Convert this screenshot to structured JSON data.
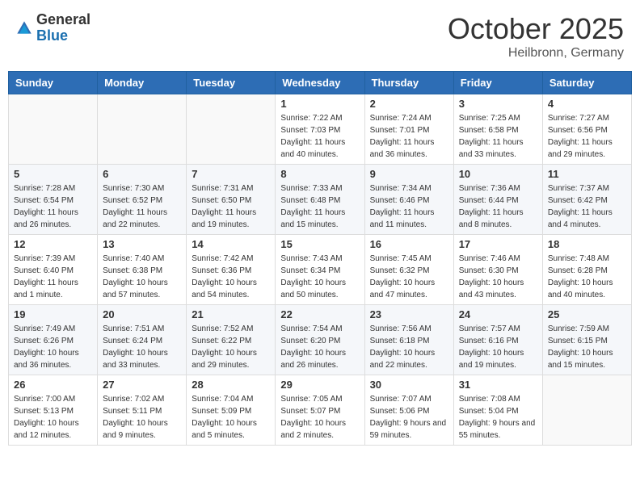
{
  "header": {
    "logo_general": "General",
    "logo_blue": "Blue",
    "month_title": "October 2025",
    "location": "Heilbronn, Germany"
  },
  "calendar": {
    "days_of_week": [
      "Sunday",
      "Monday",
      "Tuesday",
      "Wednesday",
      "Thursday",
      "Friday",
      "Saturday"
    ],
    "weeks": [
      [
        {
          "day": "",
          "sunrise": "",
          "sunset": "",
          "daylight": ""
        },
        {
          "day": "",
          "sunrise": "",
          "sunset": "",
          "daylight": ""
        },
        {
          "day": "",
          "sunrise": "",
          "sunset": "",
          "daylight": ""
        },
        {
          "day": "1",
          "sunrise": "Sunrise: 7:22 AM",
          "sunset": "Sunset: 7:03 PM",
          "daylight": "Daylight: 11 hours and 40 minutes."
        },
        {
          "day": "2",
          "sunrise": "Sunrise: 7:24 AM",
          "sunset": "Sunset: 7:01 PM",
          "daylight": "Daylight: 11 hours and 36 minutes."
        },
        {
          "day": "3",
          "sunrise": "Sunrise: 7:25 AM",
          "sunset": "Sunset: 6:58 PM",
          "daylight": "Daylight: 11 hours and 33 minutes."
        },
        {
          "day": "4",
          "sunrise": "Sunrise: 7:27 AM",
          "sunset": "Sunset: 6:56 PM",
          "daylight": "Daylight: 11 hours and 29 minutes."
        }
      ],
      [
        {
          "day": "5",
          "sunrise": "Sunrise: 7:28 AM",
          "sunset": "Sunset: 6:54 PM",
          "daylight": "Daylight: 11 hours and 26 minutes."
        },
        {
          "day": "6",
          "sunrise": "Sunrise: 7:30 AM",
          "sunset": "Sunset: 6:52 PM",
          "daylight": "Daylight: 11 hours and 22 minutes."
        },
        {
          "day": "7",
          "sunrise": "Sunrise: 7:31 AM",
          "sunset": "Sunset: 6:50 PM",
          "daylight": "Daylight: 11 hours and 19 minutes."
        },
        {
          "day": "8",
          "sunrise": "Sunrise: 7:33 AM",
          "sunset": "Sunset: 6:48 PM",
          "daylight": "Daylight: 11 hours and 15 minutes."
        },
        {
          "day": "9",
          "sunrise": "Sunrise: 7:34 AM",
          "sunset": "Sunset: 6:46 PM",
          "daylight": "Daylight: 11 hours and 11 minutes."
        },
        {
          "day": "10",
          "sunrise": "Sunrise: 7:36 AM",
          "sunset": "Sunset: 6:44 PM",
          "daylight": "Daylight: 11 hours and 8 minutes."
        },
        {
          "day": "11",
          "sunrise": "Sunrise: 7:37 AM",
          "sunset": "Sunset: 6:42 PM",
          "daylight": "Daylight: 11 hours and 4 minutes."
        }
      ],
      [
        {
          "day": "12",
          "sunrise": "Sunrise: 7:39 AM",
          "sunset": "Sunset: 6:40 PM",
          "daylight": "Daylight: 11 hours and 1 minute."
        },
        {
          "day": "13",
          "sunrise": "Sunrise: 7:40 AM",
          "sunset": "Sunset: 6:38 PM",
          "daylight": "Daylight: 10 hours and 57 minutes."
        },
        {
          "day": "14",
          "sunrise": "Sunrise: 7:42 AM",
          "sunset": "Sunset: 6:36 PM",
          "daylight": "Daylight: 10 hours and 54 minutes."
        },
        {
          "day": "15",
          "sunrise": "Sunrise: 7:43 AM",
          "sunset": "Sunset: 6:34 PM",
          "daylight": "Daylight: 10 hours and 50 minutes."
        },
        {
          "day": "16",
          "sunrise": "Sunrise: 7:45 AM",
          "sunset": "Sunset: 6:32 PM",
          "daylight": "Daylight: 10 hours and 47 minutes."
        },
        {
          "day": "17",
          "sunrise": "Sunrise: 7:46 AM",
          "sunset": "Sunset: 6:30 PM",
          "daylight": "Daylight: 10 hours and 43 minutes."
        },
        {
          "day": "18",
          "sunrise": "Sunrise: 7:48 AM",
          "sunset": "Sunset: 6:28 PM",
          "daylight": "Daylight: 10 hours and 40 minutes."
        }
      ],
      [
        {
          "day": "19",
          "sunrise": "Sunrise: 7:49 AM",
          "sunset": "Sunset: 6:26 PM",
          "daylight": "Daylight: 10 hours and 36 minutes."
        },
        {
          "day": "20",
          "sunrise": "Sunrise: 7:51 AM",
          "sunset": "Sunset: 6:24 PM",
          "daylight": "Daylight: 10 hours and 33 minutes."
        },
        {
          "day": "21",
          "sunrise": "Sunrise: 7:52 AM",
          "sunset": "Sunset: 6:22 PM",
          "daylight": "Daylight: 10 hours and 29 minutes."
        },
        {
          "day": "22",
          "sunrise": "Sunrise: 7:54 AM",
          "sunset": "Sunset: 6:20 PM",
          "daylight": "Daylight: 10 hours and 26 minutes."
        },
        {
          "day": "23",
          "sunrise": "Sunrise: 7:56 AM",
          "sunset": "Sunset: 6:18 PM",
          "daylight": "Daylight: 10 hours and 22 minutes."
        },
        {
          "day": "24",
          "sunrise": "Sunrise: 7:57 AM",
          "sunset": "Sunset: 6:16 PM",
          "daylight": "Daylight: 10 hours and 19 minutes."
        },
        {
          "day": "25",
          "sunrise": "Sunrise: 7:59 AM",
          "sunset": "Sunset: 6:15 PM",
          "daylight": "Daylight: 10 hours and 15 minutes."
        }
      ],
      [
        {
          "day": "26",
          "sunrise": "Sunrise: 7:00 AM",
          "sunset": "Sunset: 5:13 PM",
          "daylight": "Daylight: 10 hours and 12 minutes."
        },
        {
          "day": "27",
          "sunrise": "Sunrise: 7:02 AM",
          "sunset": "Sunset: 5:11 PM",
          "daylight": "Daylight: 10 hours and 9 minutes."
        },
        {
          "day": "28",
          "sunrise": "Sunrise: 7:04 AM",
          "sunset": "Sunset: 5:09 PM",
          "daylight": "Daylight: 10 hours and 5 minutes."
        },
        {
          "day": "29",
          "sunrise": "Sunrise: 7:05 AM",
          "sunset": "Sunset: 5:07 PM",
          "daylight": "Daylight: 10 hours and 2 minutes."
        },
        {
          "day": "30",
          "sunrise": "Sunrise: 7:07 AM",
          "sunset": "Sunset: 5:06 PM",
          "daylight": "Daylight: 9 hours and 59 minutes."
        },
        {
          "day": "31",
          "sunrise": "Sunrise: 7:08 AM",
          "sunset": "Sunset: 5:04 PM",
          "daylight": "Daylight: 9 hours and 55 minutes."
        },
        {
          "day": "",
          "sunrise": "",
          "sunset": "",
          "daylight": ""
        }
      ]
    ]
  }
}
